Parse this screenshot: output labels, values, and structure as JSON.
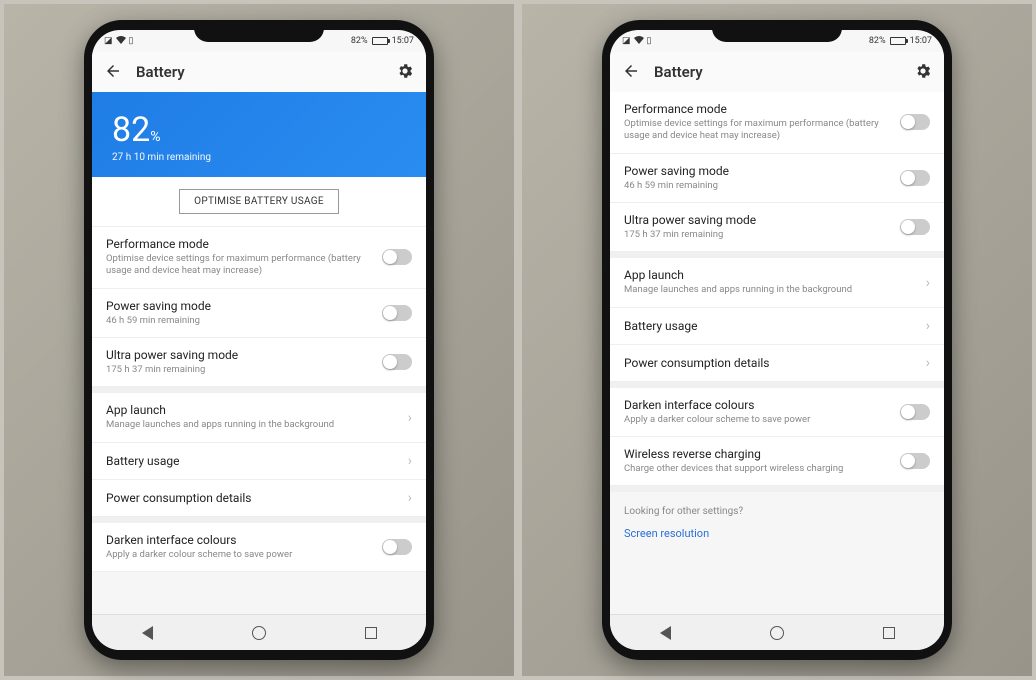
{
  "status": {
    "battery_pct": "82%",
    "time": "15:07"
  },
  "header": {
    "title": "Battery"
  },
  "banner": {
    "percent": "82",
    "percent_unit": "%",
    "remaining": "27 h 10 min remaining"
  },
  "optimise_button": "OPTIMISE BATTERY USAGE",
  "rows": {
    "performance": {
      "label": "Performance mode",
      "sub": "Optimise device settings for maximum performance (battery usage and device heat may increase)"
    },
    "power_saving": {
      "label": "Power saving mode",
      "sub": "46 h 59 min remaining"
    },
    "ultra": {
      "label": "Ultra power saving mode",
      "sub": "175 h 37 min remaining"
    },
    "app_launch": {
      "label": "App launch",
      "sub": "Manage launches and apps running in the background"
    },
    "battery_usage": {
      "label": "Battery usage"
    },
    "power_details": {
      "label": "Power consumption details"
    },
    "darken": {
      "label": "Darken interface colours",
      "sub": "Apply a darker colour scheme to save power"
    },
    "wireless": {
      "label": "Wireless reverse charging",
      "sub": "Charge other devices that support wireless charging"
    }
  },
  "footer": {
    "hint": "Looking for other settings?",
    "link": "Screen resolution"
  }
}
